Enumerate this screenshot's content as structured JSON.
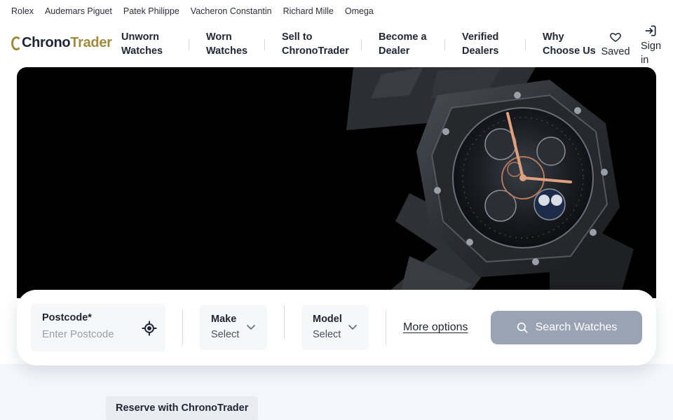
{
  "brands": [
    "Rolex",
    "Audemars Piguet",
    "Patek Philippe",
    "Vacheron Constantin",
    "Richard Mille",
    "Omega"
  ],
  "logo": {
    "part1": "Chrono",
    "part2": "Trader"
  },
  "nav": {
    "unworn": {
      "line1": "Unworn",
      "line2": "Watches"
    },
    "worn": {
      "line1": "Worn",
      "line2": "Watches"
    },
    "sell": {
      "line1": "Sell to",
      "line2": "ChronoTrader"
    },
    "dealer": {
      "line1": "Become a",
      "line2": "Dealer"
    },
    "verified": {
      "line1": "Verified",
      "line2": "Dealers"
    },
    "why": {
      "line1": "Why",
      "line2": "Choose Us"
    },
    "saved": "Saved",
    "sign_in": {
      "line1": "Sign",
      "line2": "in"
    }
  },
  "search": {
    "postcode_label": "Postcode*",
    "postcode_placeholder": "Enter Postcode",
    "make_label": "Make",
    "make_value": "Select",
    "model_label": "Model",
    "model_value": "Select",
    "more_options": "More options",
    "button": "Search Watches"
  },
  "reserve": "Reserve with ChronoTrader",
  "colors": {
    "accent_gold": "#a08a3c",
    "button": "#9aa3b3",
    "text": "#1f2533"
  },
  "icons": [
    "heart-icon",
    "sign-in-icon",
    "locate-icon",
    "chevron-down-icon",
    "search-icon"
  ]
}
